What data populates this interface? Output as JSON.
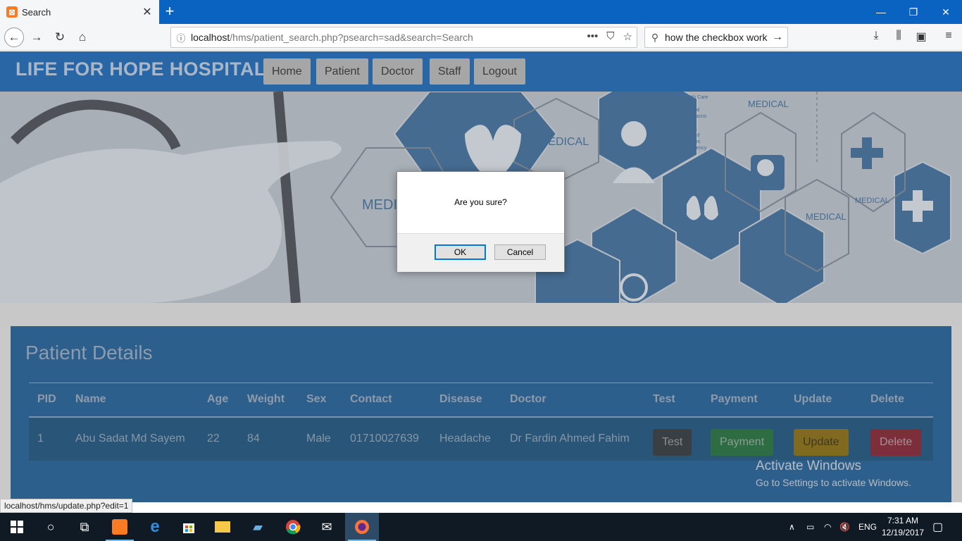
{
  "browser": {
    "tab_title": "Search",
    "url_host": "localhost",
    "url_path": "/hms/patient_search.php?psearch=sad&search=Search",
    "search_value": "how the checkbox work",
    "status_url": "localhost/hms/update.php?edit=1"
  },
  "site": {
    "brand": "LIFE FOR HOPE HOSPITAL",
    "menu": [
      "Home",
      "Patient",
      "Doctor",
      "Staff",
      "Logout"
    ]
  },
  "hero": {
    "labels": [
      "MEDICAL",
      "MEDI",
      "MEDICAL",
      "MEDICAL",
      "MEDICAL"
    ],
    "list_text": [
      "Health Care",
      "Doctor",
      "Hospital",
      "Pharmacist",
      "Nurse",
      "Dentist",
      "First Aid",
      "Surgeon",
      "Emergency"
    ]
  },
  "panel": {
    "title": "Patient Details",
    "columns": [
      "PID",
      "Name",
      "Age",
      "Weight",
      "Sex",
      "Contact",
      "Disease",
      "Doctor",
      "Test",
      "Payment",
      "Update",
      "Delete"
    ],
    "rows": [
      {
        "pid": "1",
        "name": "Abu Sadat Md Sayem",
        "age": "22",
        "weight": "84",
        "sex": "Male",
        "contact": "01710027639",
        "disease": "Headache",
        "doctor": "Dr Fardin Ahmed Fahim",
        "test_label": "Test",
        "payment_label": "Payment",
        "update_label": "Update",
        "delete_label": "Delete"
      }
    ]
  },
  "watermark": {
    "line1": "Activate Windows",
    "line2": "Go to Settings to activate Windows."
  },
  "dialog": {
    "message": "Are you sure?",
    "ok_label": "OK",
    "cancel_label": "Cancel"
  },
  "taskbar": {
    "language": "ENG",
    "time": "7:31 AM",
    "date": "12/19/2017"
  }
}
